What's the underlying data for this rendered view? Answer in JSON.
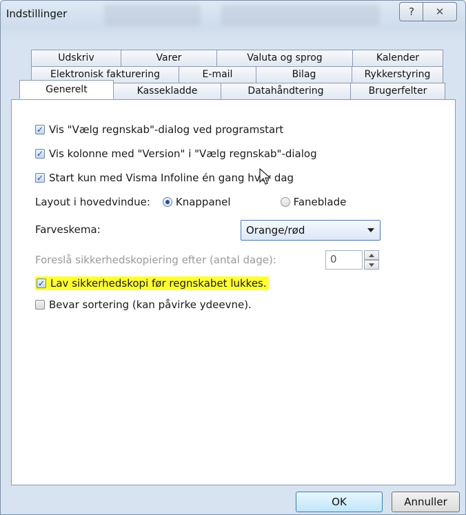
{
  "window": {
    "title": "Indstillinger"
  },
  "title_buttons": {
    "help": "?",
    "close": "✕"
  },
  "tabs": {
    "row1": [
      "Udskriv",
      "Varer",
      "Valuta og sprog",
      "Kalender"
    ],
    "row2": [
      "Elektronisk fakturering",
      "E-mail",
      "Bilag",
      "Rykkerstyring"
    ],
    "row3": [
      "Generelt",
      "Kassekladde",
      "Datahåndtering",
      "Brugerfelter"
    ],
    "selected": "Generelt"
  },
  "options": {
    "show_choose_dialog": {
      "label": "Vis \"Vælg regnskab\"-dialog ved programstart",
      "checked": true
    },
    "show_version_column": {
      "label": "Vis kolonne med \"Version\" i \"Vælg regnskab\"-dialog",
      "checked": true
    },
    "infoline_once": {
      "label": "Start kun med Visma Infoline én gang hver dag",
      "checked": true
    },
    "backup_before_close": {
      "label": "Lav sikkerhedskopi før regnskabet lukkes.",
      "checked": true,
      "highlight": "#ffff2e"
    },
    "keep_sorting": {
      "label": "Bevar sortering (kan påvirke ydeevne).",
      "checked": false
    }
  },
  "layout": {
    "label": "Layout i hovedvindue:",
    "options": [
      "Knappanel",
      "Faneblade"
    ],
    "selected": "Knappanel"
  },
  "color_scheme": {
    "label": "Farveskema:",
    "value": "Orange/rød"
  },
  "backup_days": {
    "label": "Foreslå sikkerhedskopiering efter (antal dage):",
    "value": "0"
  },
  "footer": {
    "ok": "OK",
    "cancel": "Annuller"
  },
  "colors": {
    "accent": "#1f4e9a",
    "frame": "#d7e3f1",
    "highlight": "#ffff2e"
  }
}
